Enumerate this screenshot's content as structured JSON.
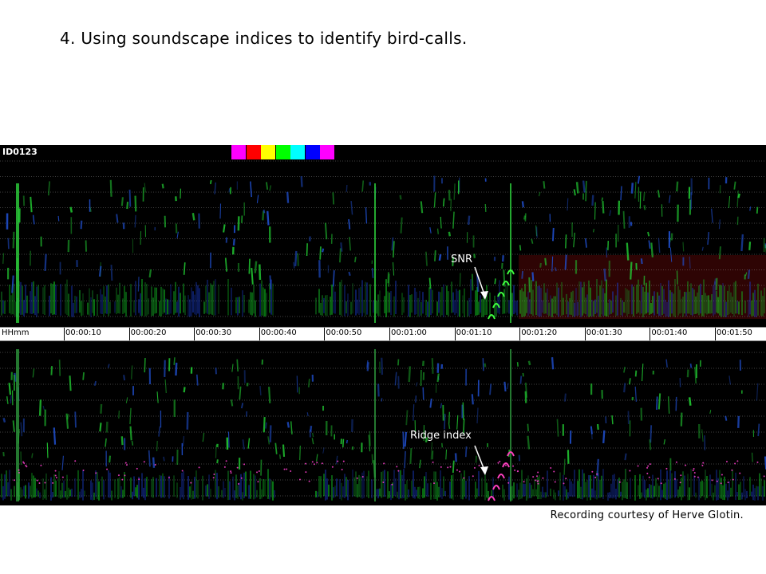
{
  "slide": {
    "title": "4. Using soundscape indices to identify bird-calls.",
    "credit": "Recording courtesy of Herve Glotin."
  },
  "figure": {
    "id_label": "ID0123",
    "swatch_colors": [
      "#ff00ff",
      "#ff0000",
      "#ffff00",
      "#00ff00",
      "#00ffff",
      "#0000ff",
      "#ff00ff"
    ],
    "time_axis": {
      "unit_label": "HHmm",
      "ticks": [
        "00:00:10",
        "00:00:20",
        "00:00:30",
        "00:00:40",
        "00:00:50",
        "00:01:00",
        "00:01:10",
        "00:01:20",
        "00:01:30",
        "00:01:40",
        "00:01:50"
      ]
    },
    "annotations": {
      "top": "SNR",
      "bottom": "Ridge index"
    }
  }
}
